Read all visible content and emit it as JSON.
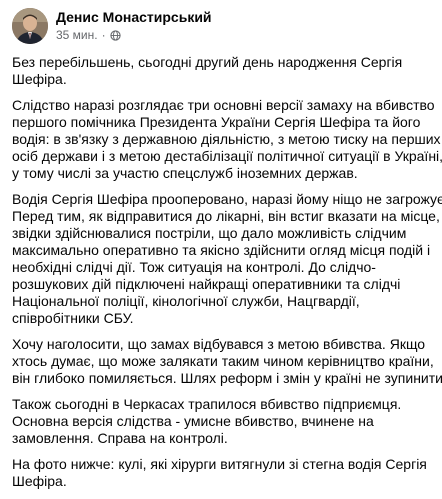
{
  "post": {
    "author": "Денис Монастирський",
    "time": "35 мин.",
    "separator": "·",
    "privacy_icon": "globe-icon",
    "paragraphs": [
      [
        "Без перебільшень, сьогодні другий день народження Сергія",
        "Шефіра."
      ],
      [
        "Слідство наразі розглядає три основні версії замаху на вбивство",
        "першого помічника Президента України Сергія Шефіра та його",
        "водія: в зв'язку з державною діяльністю, з метою тиску на перших",
        "осіб держави і з метою дестабілізації політичної ситуації в Україні,",
        "у тому числі за участю спецслужб іноземних держав."
      ],
      [
        "Водія Сергія Шефіра прооперовано, наразі йому ніщо не загрожує.",
        "Перед тим, як відправитися до лікарні, він встиг вказати на місце,",
        "звідки здійснювалися постріли, що дало можливість слідчим",
        "максимально оперативно та якісно здійснити огляд місця подій і",
        "необхідні слідчі дії. Тож ситуація на контролі. До слідчо-",
        "розшукових дій підключені найкращі оперативники та слідчі",
        "Національної поліції, кінологічної служби, Нацгвардії,",
        "співробітники СБУ."
      ],
      [
        "Хочу наголосити, що замах відбувався з метою вбивства. Якщо",
        "хтось думає, що може залякати таким чином керівництво країни,",
        "він глибоко помиляється. Шлях реформ і змін у країні не зупинити!"
      ],
      [
        "Також сьогодні в Черкасах трапилося вбивство підприємця.",
        "Основна версія слідства -  умисне вбивство, вчинене на",
        "замовлення. Справа на контролі."
      ],
      [
        "На фото нижче: кулі, які хірурги витягнули зі стегна водія Сергія",
        "Шефіра."
      ]
    ]
  }
}
